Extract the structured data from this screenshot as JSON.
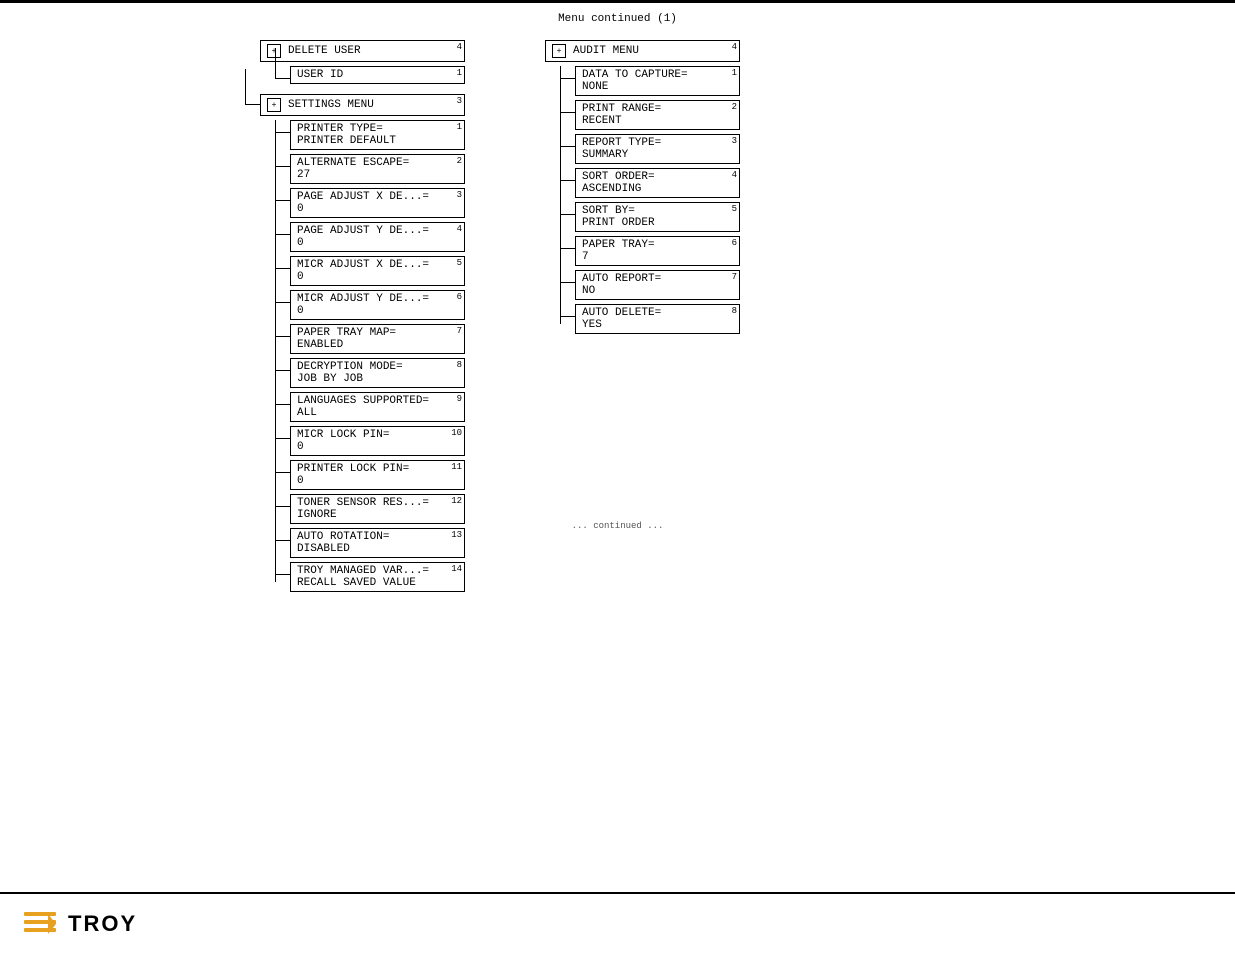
{
  "page": {
    "title": "Menu continued (1)",
    "bottom_note": "... continued ..."
  },
  "left_column": {
    "delete_user": {
      "label": "DELETE USER",
      "number": "4",
      "icon": "+"
    },
    "user_id": {
      "label": "USER ID",
      "number": "1"
    },
    "settings_menu": {
      "label": "SETTINGS MENU",
      "number": "3",
      "icon": "+"
    },
    "items": [
      {
        "number": "1",
        "line1": "PRINTER TYPE=",
        "line2": "PRINTER DEFAULT"
      },
      {
        "number": "2",
        "line1": "ALTERNATE ESCAPE=",
        "line2": "27"
      },
      {
        "number": "3",
        "line1": "PAGE ADJUST X DE...=",
        "line2": "0"
      },
      {
        "number": "4",
        "line1": "PAGE ADJUST Y DE...=",
        "line2": "0"
      },
      {
        "number": "5",
        "line1": "MICR ADJUST X DE...=",
        "line2": "0"
      },
      {
        "number": "6",
        "line1": "MICR ADJUST Y DE...=",
        "line2": "0"
      },
      {
        "number": "7",
        "line1": "PAPER TRAY MAP=",
        "line2": "ENABLED"
      },
      {
        "number": "8",
        "line1": "DECRYPTION MODE=",
        "line2": "JOB BY JOB"
      },
      {
        "number": "9",
        "line1": "LANGUAGES SUPPORTED=",
        "line2": "ALL"
      },
      {
        "number": "10",
        "line1": "MICR LOCK PIN=",
        "line2": "0"
      },
      {
        "number": "11",
        "line1": "PRINTER LOCK PIN=",
        "line2": "0"
      },
      {
        "number": "12",
        "line1": "TONER SENSOR RES...=",
        "line2": "IGNORE"
      },
      {
        "number": "13",
        "line1": "AUTO ROTATION=",
        "line2": "DISABLED"
      },
      {
        "number": "14",
        "line1": "TROY MANAGED VAR...=",
        "line2": "RECALL  SAVED VALUE"
      }
    ]
  },
  "right_column": {
    "audit_menu": {
      "label": "AUDIT MENU",
      "number": "4",
      "icon": "+"
    },
    "items": [
      {
        "number": "1",
        "line1": "DATA TO CAPTURE=",
        "line2": "NONE"
      },
      {
        "number": "2",
        "line1": "PRINT RANGE=",
        "line2": "RECENT"
      },
      {
        "number": "3",
        "line1": "REPORT TYPE=",
        "line2": "SUMMARY"
      },
      {
        "number": "4",
        "line1": "SORT ORDER=",
        "line2": "ASCENDING"
      },
      {
        "number": "5",
        "line1": "SORT BY=",
        "line2": "PRINT ORDER"
      },
      {
        "number": "6",
        "line1": "PAPER TRAY=",
        "line2": "7"
      },
      {
        "number": "7",
        "line1": "AUTO REPORT=",
        "line2": "NO"
      },
      {
        "number": "8",
        "line1": "AUTO DELETE=",
        "line2": "YES"
      }
    ]
  },
  "footer": {
    "company": "TROY",
    "logo_alt": "TROY logo"
  }
}
